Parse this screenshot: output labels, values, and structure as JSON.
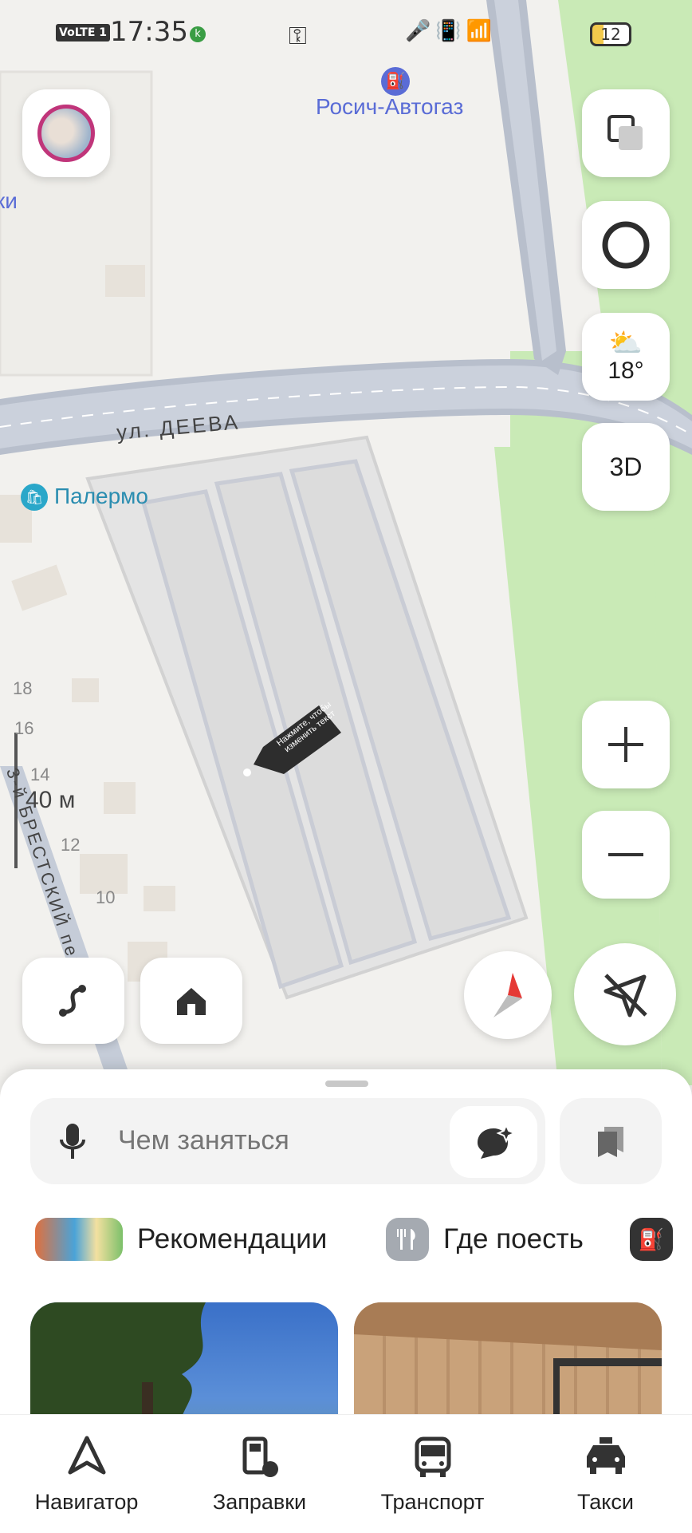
{
  "status_bar": {
    "time": "17:35",
    "network_badge": "VoLTE 1",
    "kaspersky_badge": "k",
    "battery": "12"
  },
  "map": {
    "poi_gas": "Росич-Автогаз",
    "poi_shop": "Палермо",
    "street": "ул. ДЕЕВА",
    "lane": "3-й БРЕСТСКИЙ пер.",
    "left_fragment": "ки",
    "house_numbers": [
      "18",
      "16",
      "14",
      "12",
      "10"
    ],
    "scale": "40 м",
    "marker_hint": "Нажмите, чтобы изменить текст",
    "weather_temp": "18°",
    "mode_3d": "3D",
    "accent": "#5a6cd6",
    "grass": "#c9eab6"
  },
  "sheet": {
    "search_placeholder": "Чем заняться",
    "categories": [
      {
        "label": "Рекомендации",
        "icon": "recommendations-icon"
      },
      {
        "label": "Где поесть",
        "icon": "fork-knife-icon"
      }
    ]
  },
  "tabs": [
    {
      "label": "Навигатор",
      "icon": "navigator-arrow-icon"
    },
    {
      "label": "Заправки",
      "icon": "gas-station-icon"
    },
    {
      "label": "Транспорт",
      "icon": "bus-icon"
    },
    {
      "label": "Такси",
      "icon": "taxi-icon"
    }
  ]
}
